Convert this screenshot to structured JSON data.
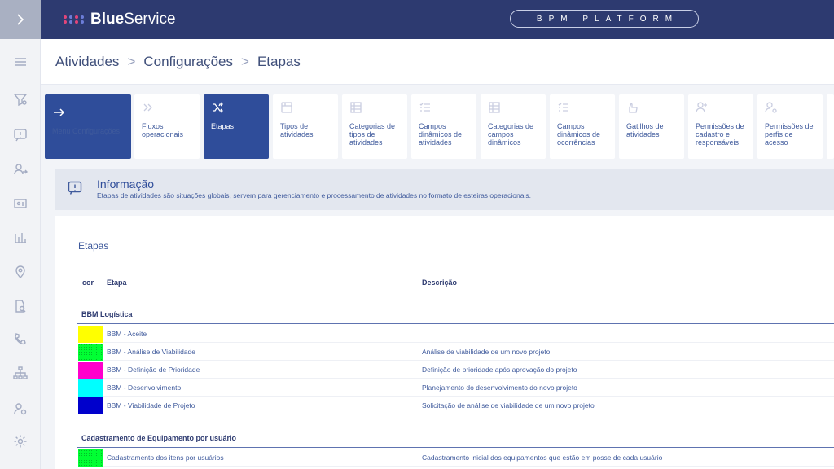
{
  "brand": {
    "logo_bold": "Blue",
    "logo_rest": "Service",
    "platform": "BPM PLATFORM"
  },
  "breadcrumb": [
    "Atividades",
    "Configurações",
    "Etapas"
  ],
  "breadcrumb_sep": ">",
  "menu_tile": {
    "label": "Menu Configurações"
  },
  "tiles": [
    {
      "label": "Fluxos operacionais",
      "icon": "chevrons-right-icon",
      "active": false
    },
    {
      "label": "Etapas",
      "icon": "shuffle-icon",
      "active": true
    },
    {
      "label": "Tipos de atividades",
      "icon": "card-icon",
      "active": false
    },
    {
      "label": "Categorias de tipos de atividades",
      "icon": "table-icon",
      "active": false
    },
    {
      "label": "Campos dinâmicos de atividades",
      "icon": "list-icon",
      "active": false
    },
    {
      "label": "Categorias de campos dinâmicos",
      "icon": "table-icon",
      "active": false
    },
    {
      "label": "Campos dinâmicos de ocorrências",
      "icon": "list-icon",
      "active": false
    },
    {
      "label": "Gatilhos de atividades",
      "icon": "hand-icon",
      "active": false
    },
    {
      "label": "Permissões de cadastro e responsáveis",
      "icon": "user-plus-icon",
      "active": false
    },
    {
      "label": "Permissões de perfis de acesso",
      "icon": "user-gear-icon",
      "active": false
    }
  ],
  "info": {
    "title": "Informação",
    "text": "Etapas de atividades são situações globais, servem para gerenciamento e processamento de atividades no formato de esteiras operacionais."
  },
  "panel": {
    "title": "Etapas",
    "columns": {
      "color": "cor",
      "stage": "Etapa",
      "description": "Descrição"
    },
    "groups": [
      {
        "name": "BBM Logística",
        "rows": [
          {
            "color": "#ffff00",
            "stage": "BBM - Aceite",
            "description": ""
          },
          {
            "color": "#00ff33",
            "stage": "BBM - Análise de Viabilidade",
            "description": "Análise de viabilidade de um novo projeto"
          },
          {
            "color": "#ff00cc",
            "stage": "BBM - Definição de Prioridade",
            "description": "Definição de prioridade após aprovação do projeto"
          },
          {
            "color": "#00ffff",
            "stage": "BBM - Desenvolvimento",
            "description": "Planejamento do desenvolvimento do novo projeto"
          },
          {
            "color": "#0000cc",
            "stage": "BBM - Viabilidade de Projeto",
            "description": "Solicitação de análise de viabilidade de um novo projeto"
          }
        ]
      },
      {
        "name": "Cadastramento de Equipamento por usuário",
        "rows": [
          {
            "color": "#00ff33",
            "stage": "Cadastramento dos itens por usuários",
            "description": "Cadastramento inicial dos equipamentos que estão em posse de cada usuário"
          }
        ]
      }
    ]
  },
  "sidebar": {
    "icons": [
      "menu-icon",
      "filter-icon",
      "alert-icon",
      "user-arrow-icon",
      "id-card-icon",
      "chart-icon",
      "location-icon",
      "document-search-icon",
      "phone-icon",
      "org-chart-icon",
      "user-settings-icon",
      "settings-icon"
    ]
  }
}
